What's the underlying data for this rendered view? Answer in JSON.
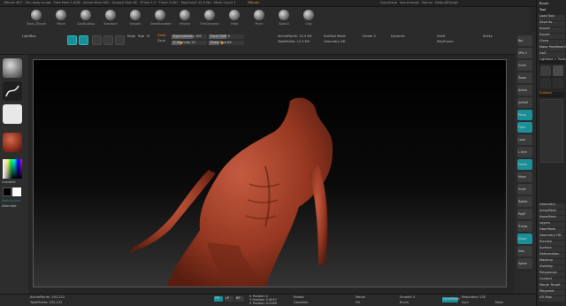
{
  "colors": {
    "accent": "#1b8f98",
    "highlight": "#e88a17",
    "model": "#a7452f"
  },
  "menubar": {
    "title": "ZBrush 4R7 · Zhu body sculpt · Free Mem 1.6GB · Active Mem 562 · Scratch Disk 48 · ZTime 1.2 · Timer 0.001 · PolyCount 12.9 Mp · Mesh Count 1",
    "status": "ZBrush",
    "menus": [
      "QuickSave",
      "See-through",
      "Menus",
      "DefaultZScript"
    ]
  },
  "shelf": {
    "tools": [
      {
        "icon": "sphere-icon",
        "label": "Tools_ZBrush"
      },
      {
        "icon": "sphere-icon",
        "label": "Move"
      },
      {
        "icon": "sphere-icon",
        "label": "ClayBuildup"
      },
      {
        "icon": "sphere-icon",
        "label": "Standard"
      },
      {
        "icon": "sphere-icon",
        "label": "Smooth"
      },
      {
        "icon": "sphere-icon",
        "label": "DamStandard"
      },
      {
        "icon": "sphere-icon",
        "label": "hPolish"
      },
      {
        "icon": "sphere-icon",
        "label": "TrimDynamic"
      },
      {
        "icon": "sphere-icon",
        "label": "Inflat"
      },
      {
        "icon": "sphere-icon",
        "label": "Pinch"
      },
      {
        "icon": "sphere-icon",
        "label": "Slash3"
      },
      {
        "icon": "sphere-icon",
        "label": "Clay"
      }
    ]
  },
  "toolbar": {
    "lightbox": "LightBox",
    "edit": "Edit",
    "draw": "Draw",
    "move": "Move",
    "scale": "Scale",
    "rotate": "Rotate",
    "mrgb": "Mrgb",
    "rgb": "Rgb",
    "m": "M",
    "zadd": "Zadd",
    "zsub": "Zsub",
    "zcut": "Zcut",
    "focal_shift": "Focal Shift 0",
    "draw_size": "Draw Size 64",
    "z_intensity": "Z Intensity 25",
    "active_points": "ActivePoints: 12.9 Mil",
    "total_points": "TotalPoints: 12.9 Mil",
    "dynamic": "Dynamic",
    "cal": "Cal",
    "pol": "Pol",
    "rgb_intensity": "Rgb Intensity 100",
    "sub_tool": "SubTool Mode",
    "geometry": "Geometry HD",
    "divide": "Divide 5",
    "draft": "Draft",
    "polyframe": "PolyFrame",
    "sticky": "Sticky"
  },
  "brush_panel": {
    "title": "Brush",
    "subtitle": "Tool",
    "items": [
      "Load Tool",
      "Save As",
      "Import",
      "Export",
      "Clone",
      "Make PolyMesh3D",
      "GoZ",
      "All",
      "Visible",
      "R",
      "Lightbox > Tools",
      "SKF_Hatch 48",
      "Subtool",
      "Geometry",
      "ArrayMesh",
      "NanoMesh",
      "Layers",
      "FiberMesh",
      "Geometry HD",
      "Preview",
      "Surface",
      "Deformation",
      "Masking",
      "Visibility",
      "Polygroups",
      "Contact",
      "Morph Target",
      "Polypaint",
      "UV Map",
      "Texture Map",
      "Displacement Map",
      "Normal Map",
      "Vector Displacement",
      "Display Properties",
      "Unified Skin",
      "Initialize",
      "Import",
      "Export"
    ]
  },
  "right_tray": [
    "Bpr",
    "SPix 3",
    "Scroll",
    "Zoom",
    "Actual",
    "AAHalf",
    "Persp",
    "Floor",
    "Local",
    "L.Sym",
    "Frame",
    "Move",
    "Scale",
    "Rotate",
    "PolyF",
    "Transp",
    "Ghost",
    "Solo",
    "Xpose"
  ],
  "status": {
    "active_points": "ActivePoints: 292,122",
    "total_points": "TotalPoints: 292,122",
    "pos": "D",
    "buttons": [
      "PM",
      "LP",
      "BP"
    ],
    "position_x": "X Position 0",
    "position_y": "Y Position 0.0097",
    "position_z": "Z Position 0.0000",
    "rotate": "Rotate",
    "geodesic": "Geodesic",
    "morph": "Morph",
    "fill": "Fill",
    "brush": "Brush",
    "smooth": "Smooth 4",
    "dynamesh": "DynaMesh",
    "resolution": "Resolution 128",
    "sym": "Sym",
    "mask": "Mask"
  },
  "left_tray": {
    "label_top": "StandBrushes",
    "color_label": "Gradient",
    "switch": "SwitchColor",
    "alternate": "Alternate"
  }
}
